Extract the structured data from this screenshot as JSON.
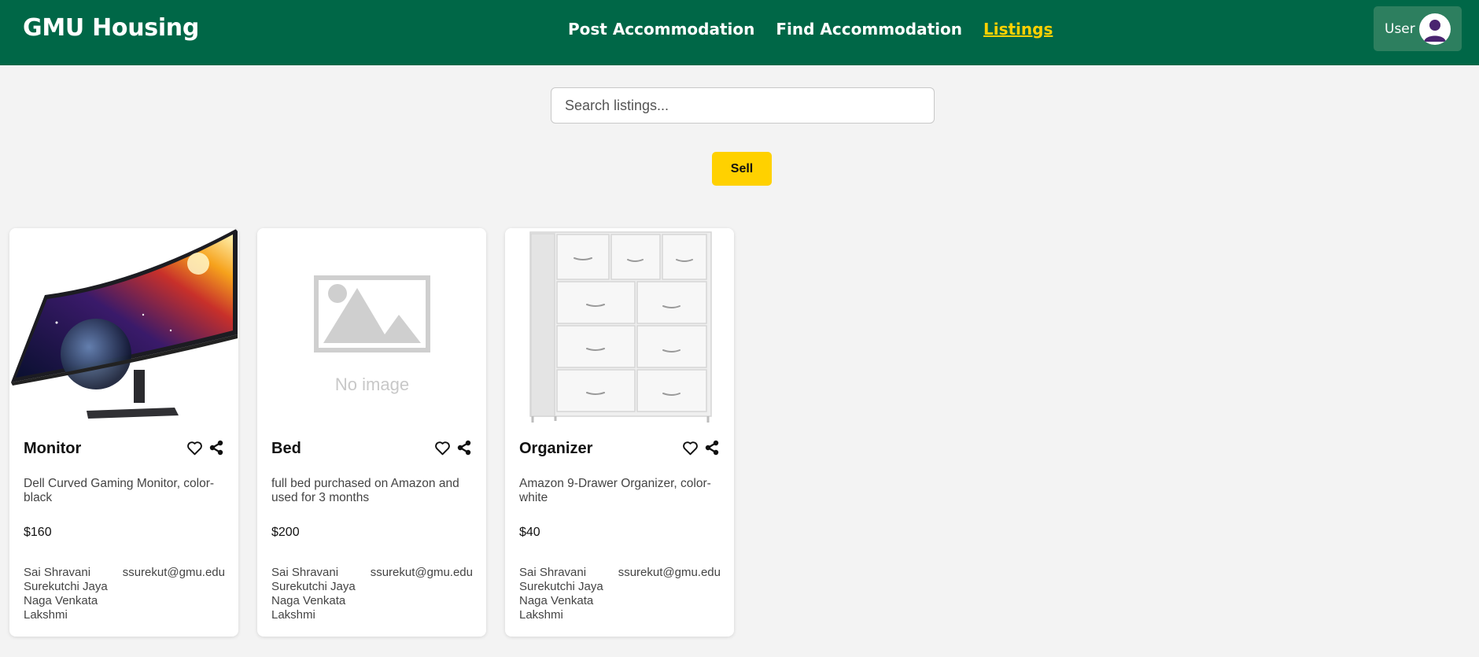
{
  "header": {
    "brand": "GMU Housing",
    "nav": [
      {
        "label": "Post Accommodation"
      },
      {
        "label": "Find Accommodation"
      },
      {
        "label": "Listings",
        "active": true
      }
    ],
    "user_label": "User",
    "colors": {
      "header_bg": "#006747",
      "accent": "#ffd100"
    }
  },
  "search": {
    "placeholder": "Search listings...",
    "value": ""
  },
  "sell_label": "Sell",
  "listings": [
    {
      "image": "monitor-photo",
      "title": "Monitor",
      "description": "Dell Curved Gaming Monitor, color-black",
      "price": "$160",
      "seller_name": "Sai Shravani Surekutchi Jaya Naga Venkata Lakshmi",
      "seller_email": "ssurekut@gmu.edu"
    },
    {
      "image": "no-image-placeholder",
      "no_image_text": "No image",
      "title": "Bed",
      "description": "full bed purchased on Amazon and used for 3 months",
      "price": "$200",
      "seller_name": "Sai Shravani Surekutchi Jaya Naga Venkata Lakshmi",
      "seller_email": "ssurekut@gmu.edu"
    },
    {
      "image": "organizer-photo",
      "title": "Organizer",
      "description": "Amazon 9-Drawer Organizer, color-white",
      "price": "$40",
      "seller_name": "Sai Shravani Surekutchi Jaya Naga Venkata Lakshmi",
      "seller_email": "ssurekut@gmu.edu"
    }
  ]
}
